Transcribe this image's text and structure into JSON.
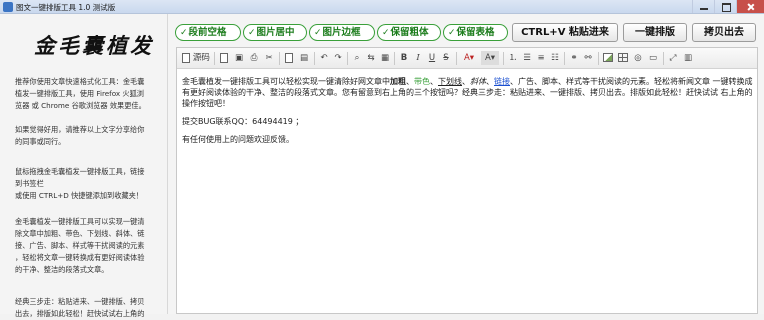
{
  "window": {
    "title": "图文一键排版工具 1.0 测试版"
  },
  "sidebar": {
    "logo": "金毛囊植发",
    "paragraphs": [
      "推荐你使用文章快速格式化工具：金毛囊\n植发一键排版工具，使用 Firefox 火狐浏\n览器 或 Chrome 谷歌浏览器 效果更佳。",
      "如果觉得好用，请推荐以上文字分享给你\n的同事或同行。",
      "鼠标拖拽金毛囊植发一键排版工具，链接\n到书签栏\n或使用 CTRL+D 快捷键添加到收藏夹！",
      "金毛囊植发一键排版工具可以实现一键清\n除文章中加粗、带色、下划线、斜体、链\n接、广告、脚本、样式等干扰阅读的元素\n，轻松将文章一键转换成有更好阅读体验\n的干净、整洁的段落式文章。",
      "经典三步走：粘贴进来、一键排版、拷贝\n出去，排版如此轻松！赶快试试右上角的"
    ]
  },
  "options": [
    {
      "label": "段前空格"
    },
    {
      "label": "图片居中"
    },
    {
      "label": "图片边框"
    },
    {
      "label": "保留粗体"
    },
    {
      "label": "保留表格"
    }
  ],
  "actions": {
    "paste": "CTRL+V 粘贴进来",
    "format": "一键排版",
    "copy": "拷贝出去"
  },
  "toolbar": {
    "source": "源码",
    "bold": "B",
    "italic": "I",
    "underline": "U",
    "strike": "S",
    "font_color": "A",
    "bg_color": "A"
  },
  "content": {
    "p1_a": "金毛囊植发一键排版工具可以轻松实现一键清除好网文章中",
    "p1_bold": "加粗",
    "p1_sep1": "、",
    "p1_color": "带色",
    "p1_sep2": "、",
    "p1_under": "下划线",
    "p1_sep3": "、",
    "p1_italic": "斜体",
    "p1_sep4": "、",
    "p1_link": "链接",
    "p1_b": "、广告、脚本、样式等干扰阅读的元素。轻松将新闻文章 一键转换成有更好阅读体验的干净、整洁的段落式文章。您有留意到右上角的三个按钮吗？经典三步走：粘贴进来、一键排版、拷贝出去。排版如此轻松！赶快试试 右上角的操作按钮吧！",
    "p2": "提交BUG联系QQ：64494419 ；",
    "p3": "有任何使用上的问题欢迎反馈。"
  },
  "colors": {
    "option_green": "#3aa03a",
    "link_blue": "#1a4fd0"
  }
}
